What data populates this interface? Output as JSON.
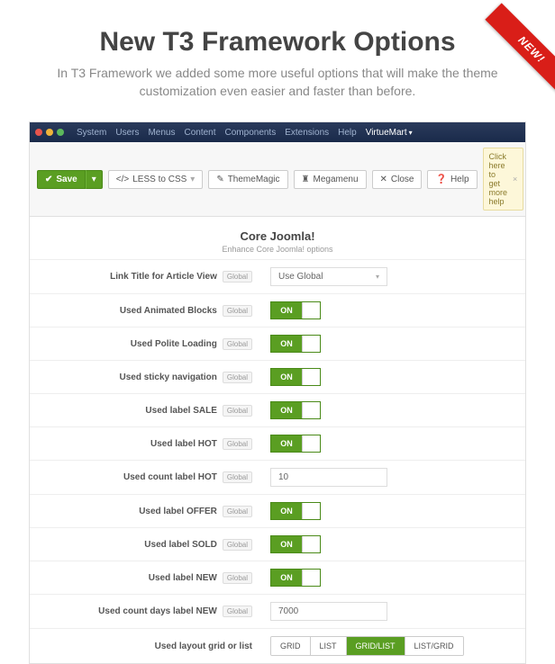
{
  "ribbon": "NEW!",
  "page": {
    "title": "New T3 Framework Options",
    "subtitle": "In T3 Framework we added some more useful options that will make the theme customization even easier and faster than before."
  },
  "menubar": {
    "items": [
      "System",
      "Users",
      "Menus",
      "Content",
      "Components",
      "Extensions",
      "Help"
    ],
    "active": "VirtueMart"
  },
  "toolbar": {
    "save": "Save",
    "less": "LESS to CSS",
    "thememagic": "ThemeMagic",
    "megamenu": "Megamenu",
    "close": "Close",
    "help": "Help",
    "tip": "Click here to get more help"
  },
  "section": {
    "title": "Core Joomla!",
    "subtitle": "Enhance Core Joomla! options"
  },
  "badges": {
    "global": "Global"
  },
  "rows": {
    "link_title": {
      "label": "Link Title for Article View",
      "value": "Use Global"
    },
    "animated": {
      "label": "Used Animated Blocks",
      "on": "ON"
    },
    "polite": {
      "label": "Used Polite Loading",
      "on": "ON"
    },
    "sticky": {
      "label": "Used sticky navigation",
      "on": "ON"
    },
    "sale": {
      "label": "Used label SALE",
      "on": "ON"
    },
    "hot": {
      "label": "Used label HOT",
      "on": "ON"
    },
    "hot_count": {
      "label": "Used count label HOT",
      "value": "10"
    },
    "offer": {
      "label": "Used label OFFER",
      "on": "ON"
    },
    "sold": {
      "label": "Used label SOLD",
      "on": "ON"
    },
    "new": {
      "label": "Used label NEW",
      "on": "ON"
    },
    "new_count": {
      "label": "Used count days label NEW",
      "value": "7000"
    },
    "layout": {
      "label": "Used layout grid or list",
      "options": [
        "GRID",
        "LIST",
        "GRID/LIST",
        "LIST/GRID"
      ],
      "active": 2
    }
  }
}
